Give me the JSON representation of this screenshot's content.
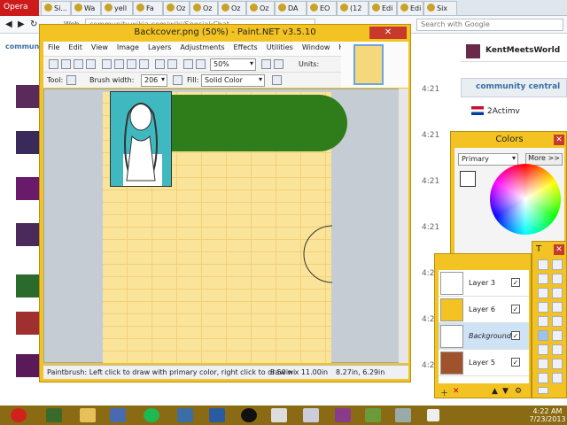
{
  "browser": {
    "opera_label": "Opera",
    "tabs": [
      "Si...",
      "Wa",
      "yell",
      "Fa",
      "Oz",
      "Oz",
      "Oz",
      "Oz",
      "DA",
      "EO",
      "(12",
      "Edi",
      "Edi",
      "Six"
    ],
    "url": "community.wikia.com/wiki/Special:Chat",
    "url_prefix": "Web",
    "search_placeholder": "Search with Google"
  },
  "wikia": {
    "logo": "community",
    "current_user": "KentMeetsWorld",
    "channel": "community central",
    "users": [
      "2Actimv"
    ],
    "timestamps": [
      "4:21",
      "4:21",
      "4:21",
      "4:21",
      "4:21",
      "4:21",
      "4:21"
    ]
  },
  "paintnet": {
    "title": "Backcover.png (50%) - Paint.NET v3.5.10",
    "menu": [
      "File",
      "Edit",
      "View",
      "Image",
      "Layers",
      "Adjustments",
      "Effects",
      "Utilities",
      "Window",
      "Help"
    ],
    "zoom": "50%",
    "units_label": "Units:",
    "tool_label": "Tool:",
    "brush_width_label": "Brush width:",
    "brush_width": "206",
    "fill_label": "Fill:",
    "fill": "Solid Color",
    "status_hint": "Paintbrush: Left click to draw with primary color, right click to draw wi",
    "image_size": "8.50in x 11.00in",
    "cursor_pos": "8.27in, 6.29in"
  },
  "colors_window": {
    "title": "Colors",
    "selector": "Primary",
    "more_button": "More >>"
  },
  "tools_window": {
    "title": "T"
  },
  "layers_window": {
    "layers": [
      {
        "name": "Layer 3",
        "checked": "✓"
      },
      {
        "name": "Layer 6",
        "checked": "✓"
      },
      {
        "name": "Background",
        "checked": "✓"
      },
      {
        "name": "Layer 5",
        "checked": "✓"
      }
    ]
  },
  "taskbar": {
    "time": "4:22 AM",
    "date": "7/23/2013"
  },
  "colors": {
    "pdn_frame": "#f3c324",
    "banner_green": "#2f7d1a",
    "canvas_yellow": "#fae49a",
    "close_red": "#c7392b"
  }
}
